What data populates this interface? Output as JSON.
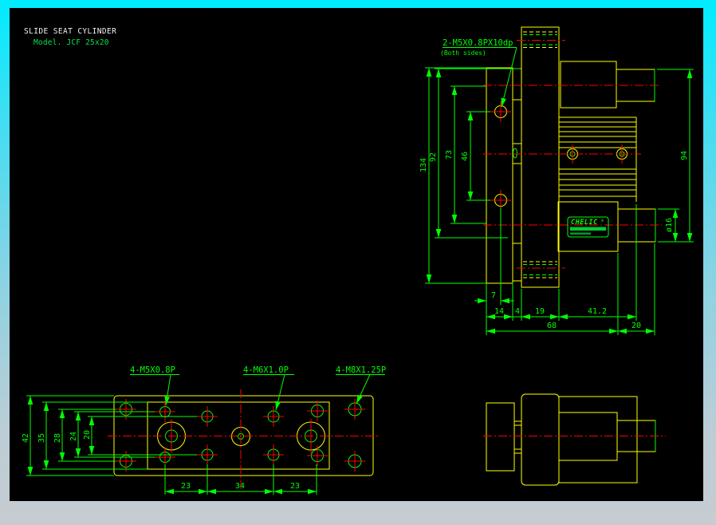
{
  "title": {
    "product": "SLIDE SEAT CYLINDER",
    "model": "Model. JCF 25x20"
  },
  "colors": {
    "outline": "#ffff00",
    "dimension": "#00ff00",
    "centerline": "#ff0000",
    "title_text": "#f2f2f2",
    "canvas_bg": "#000000",
    "border_top": "#00ecff",
    "border_bottom": "#c6ccd2"
  },
  "front_view": {
    "thread_note": "2-M5X0.8PX10dp",
    "thread_note_sub": "(Both sides)",
    "brand": "CHELIC",
    "brand_mark": "®",
    "dims": {
      "h134": "134",
      "h92": "92",
      "h73": "73",
      "h46": "46",
      "h94": "94",
      "dia16": "ø16",
      "w7": "7",
      "w14": "14",
      "w4": "4",
      "w19": "19",
      "w41_2": "41.2",
      "w68": "68",
      "w20": "20"
    }
  },
  "top_view": {
    "note_m5": "4-M5X0.8P",
    "note_m6": "4-M6X1.0P",
    "note_m8": "4-M8X1.25P",
    "dims": {
      "h42": "42",
      "h35": "35",
      "h28": "28",
      "h24": "24",
      "h20": "20",
      "p23a": "23",
      "p34": "34",
      "p23b": "23"
    }
  }
}
